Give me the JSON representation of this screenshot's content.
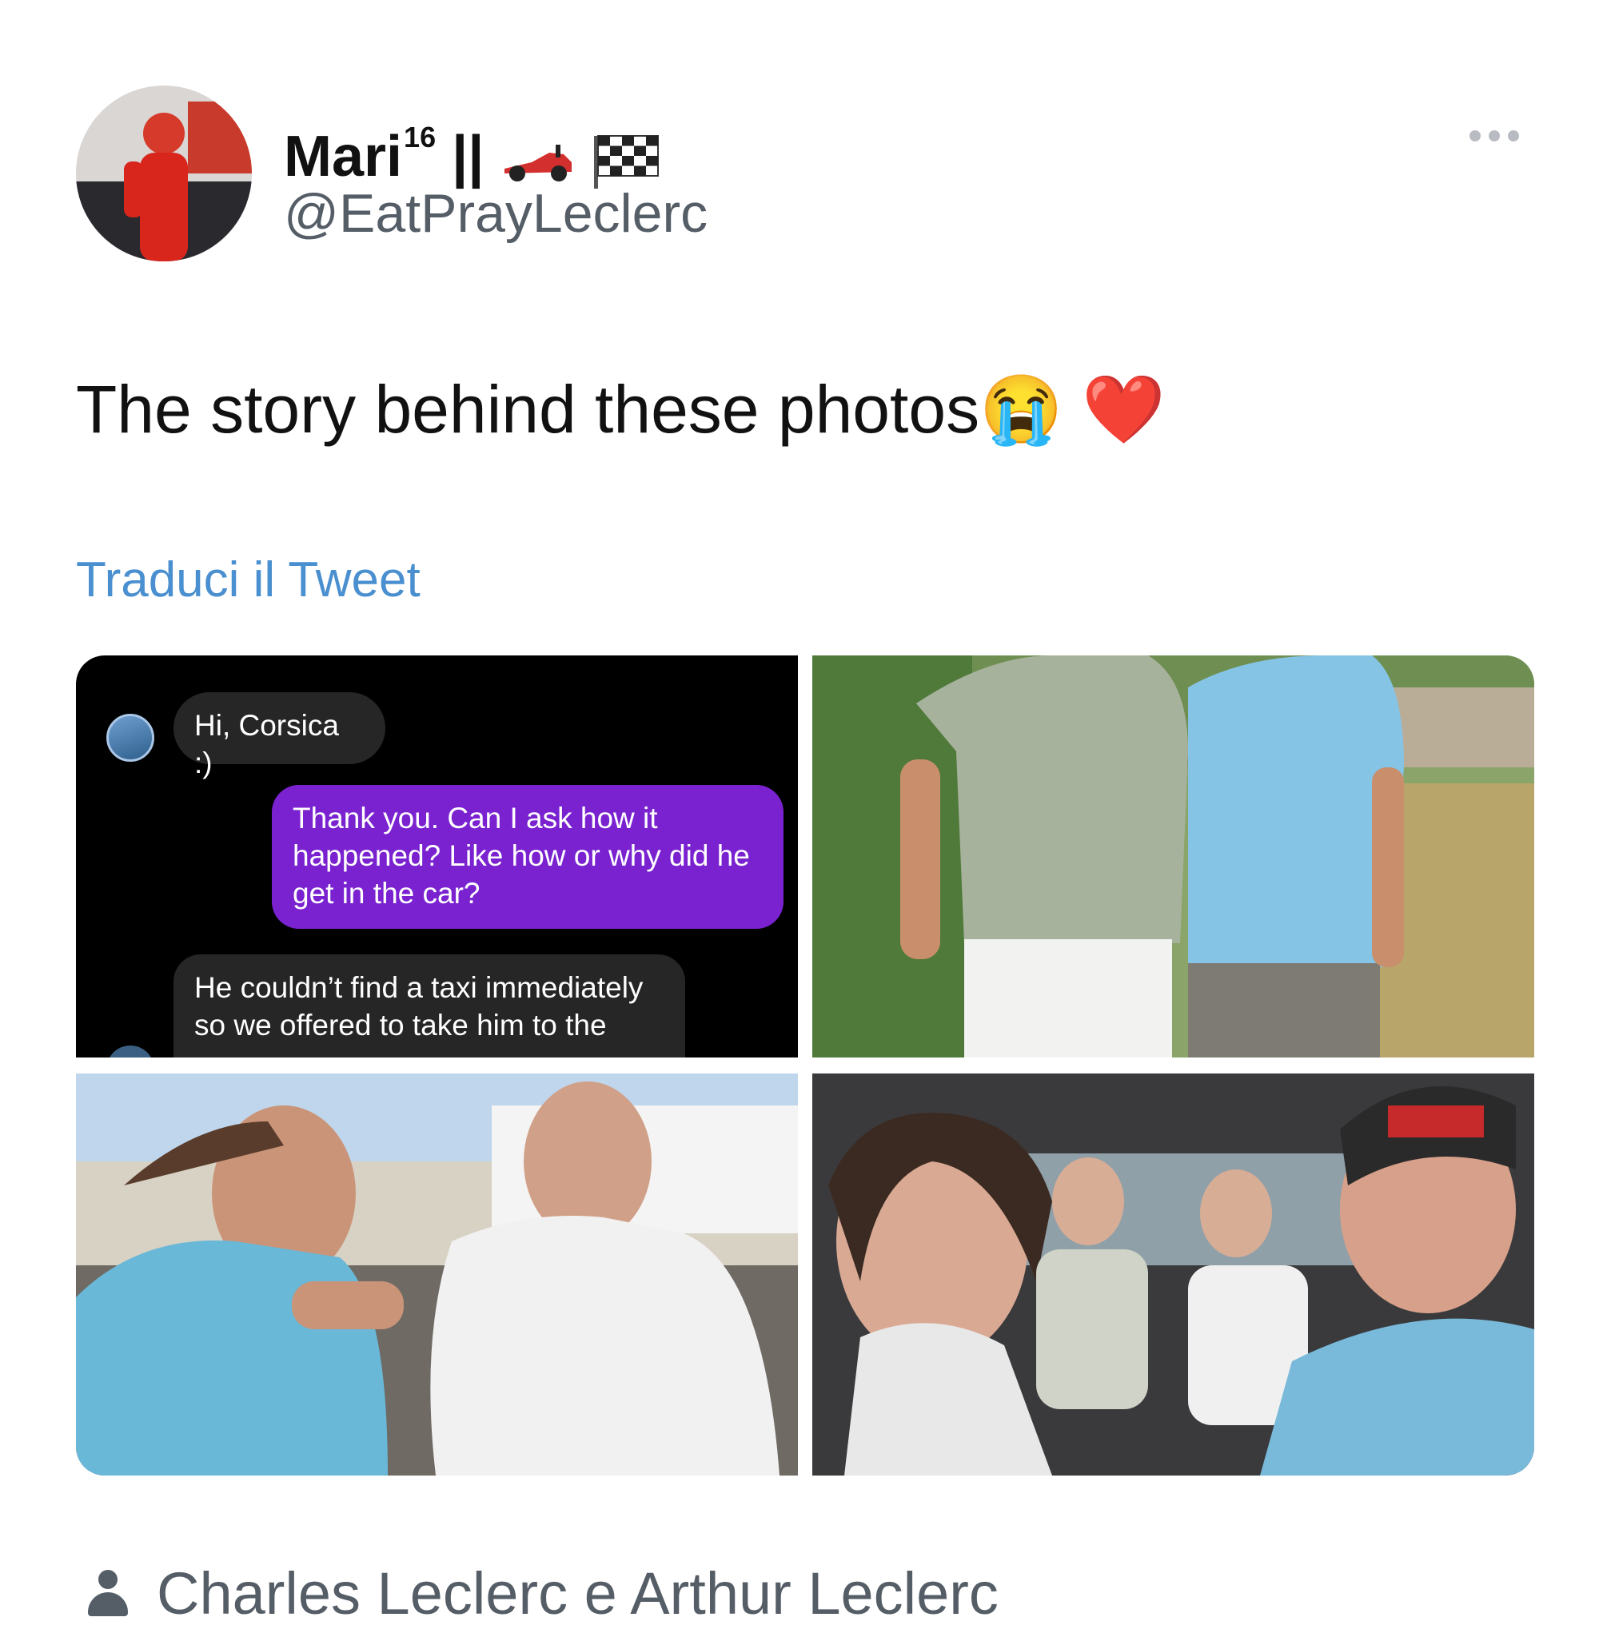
{
  "author": {
    "display_name": "Mari",
    "display_name_sup": "16",
    "display_name_suffix": "||",
    "handle": "@EatPrayLeclerc",
    "avatar": "profile-photo"
  },
  "more_icon": "ellipsis-icon",
  "tweet": {
    "text": "The story behind these photos",
    "emoji": [
      "😭",
      "❤️"
    ]
  },
  "translate_label": "Traduci il Tweet",
  "chat": {
    "incoming_1": "Hi, Corsica :)",
    "outgoing": "Thank you. Can I ask how it happened? Like how or why did he get in the car?",
    "incoming_2": "He couldn’t find a taxi immediately so we offered to take him to the"
  },
  "tagged": {
    "icon": "person-icon",
    "text": "Charles Leclerc e Arthur Leclerc"
  },
  "colors": {
    "link": "#4a90d0",
    "secondary_text": "#555d66",
    "chat_outgoing": "#7a22d0",
    "chat_incoming": "#262626"
  }
}
